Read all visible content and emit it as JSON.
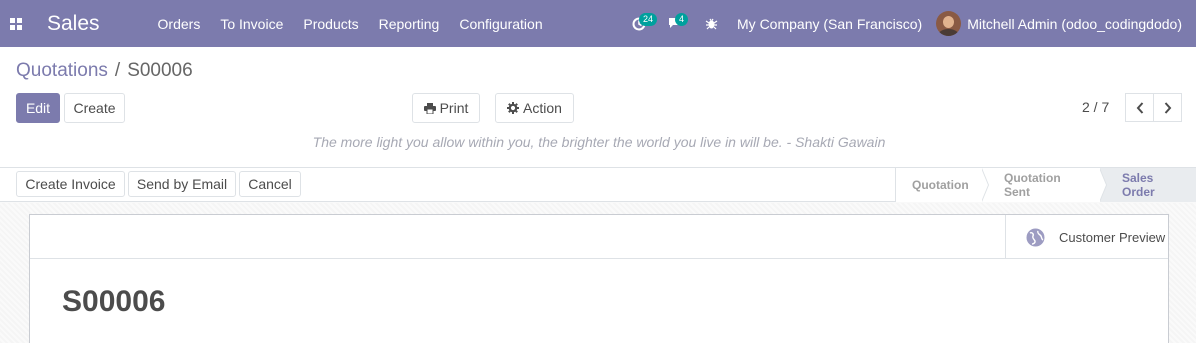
{
  "navbar": {
    "apps_icon": "apps-grid-icon",
    "app_name": "Sales",
    "menu": [
      "Orders",
      "To Invoice",
      "Products",
      "Reporting",
      "Configuration"
    ],
    "activity_badge": "24",
    "messages_badge": "4",
    "company": "My Company (San Francisco)",
    "user": "Mitchell Admin (odoo_codingdodo)"
  },
  "breadcrumb": {
    "parent": "Quotations",
    "separator": "/",
    "current": "S00006"
  },
  "toolbar": {
    "edit": "Edit",
    "create": "Create",
    "print": "Print",
    "action": "Action"
  },
  "pager": {
    "value": "2 / 7"
  },
  "quote": "The more light you allow within you, the brighter the world you live in will be. - Shakti Gawain",
  "statusbar": {
    "buttons": [
      "Create Invoice",
      "Send by Email",
      "Cancel"
    ],
    "stages": [
      "Quotation",
      "Quotation Sent",
      "Sales Order"
    ],
    "active_stage": "Sales Order"
  },
  "form": {
    "smart_button": "Customer Preview",
    "title": "S00006"
  },
  "colors": {
    "brand": "#7c7bad",
    "badge": "#00a09d"
  }
}
